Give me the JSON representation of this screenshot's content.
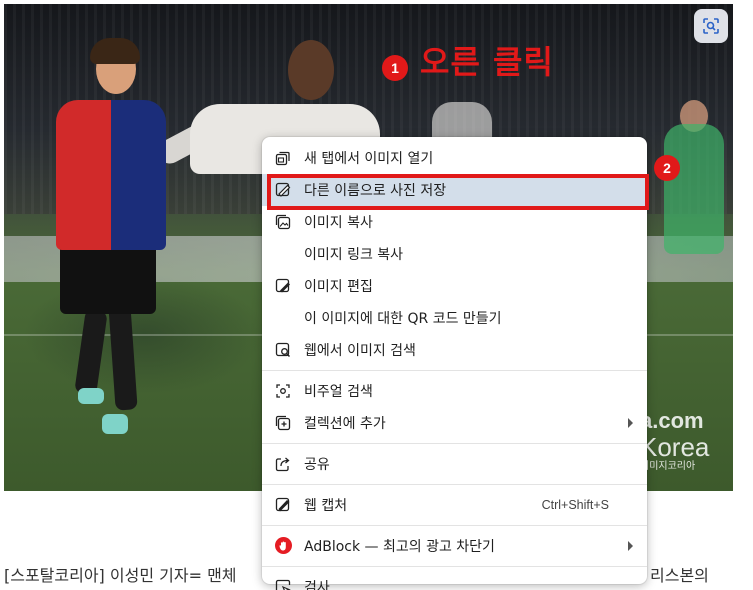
{
  "annotations": {
    "step1_number": "1",
    "step1_text": "오른 클릭",
    "step2_number": "2",
    "accent_color": "#e11919"
  },
  "photo": {
    "watermark_line1": "a.com",
    "watermark_line2": "Korea",
    "watermark_line3": "이미지코리아",
    "lens_icon": "google-lens-icon"
  },
  "context_menu": {
    "items": [
      {
        "label": "새 탭에서 이미지 열기",
        "icon": "open-in-new-tab-icon"
      },
      {
        "label": "다른 이름으로 사진 저장",
        "icon": "save-image-icon",
        "highlighted": true
      },
      {
        "label": "이미지 복사",
        "icon": "copy-image-icon"
      },
      {
        "label": "이미지 링크 복사",
        "icon": ""
      },
      {
        "label": "이미지 편집",
        "icon": "edit-image-icon"
      },
      {
        "label": "이 이미지에 대한 QR 코드 만들기",
        "icon": ""
      },
      {
        "label": "웹에서 이미지 검색",
        "icon": "search-image-icon"
      },
      {
        "label": "비주얼 검색",
        "icon": "visual-search-icon"
      },
      {
        "label": "컬렉션에 추가",
        "icon": "add-collection-icon",
        "submenu": true
      },
      {
        "label": "공유",
        "icon": "share-icon"
      },
      {
        "label": "웹 캡처",
        "icon": "web-capture-icon",
        "shortcut": "Ctrl+Shift+S"
      },
      {
        "label": "AdBlock — 최고의 광고 차단기",
        "icon": "adblock-icon",
        "submenu": true
      },
      {
        "label": "검사",
        "icon": "inspect-icon"
      }
    ],
    "highlight_color": "#d3deea"
  },
  "article": {
    "left_text": "[스포탈코리아] 이성민 기자= 맨체",
    "right_text": "리스본의"
  }
}
